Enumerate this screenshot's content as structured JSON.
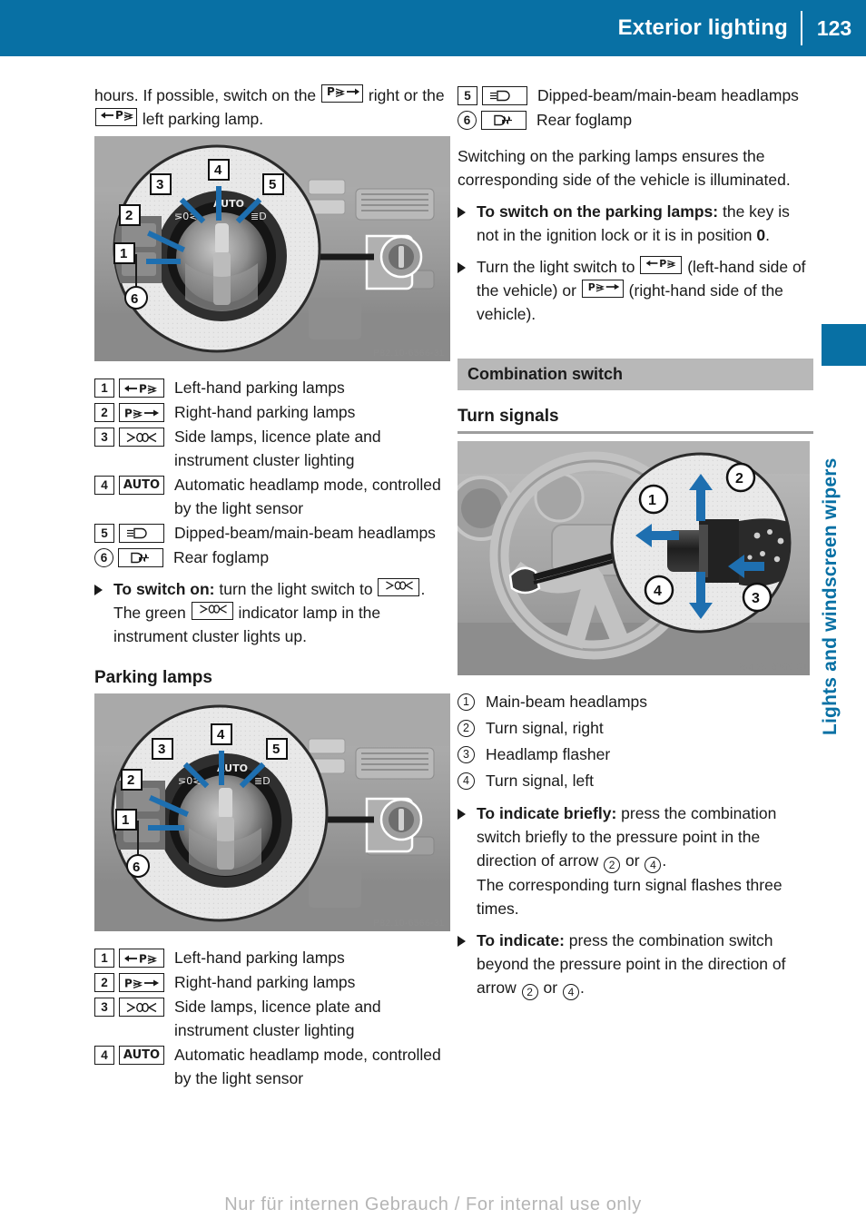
{
  "header": {
    "title": "Exterior lighting",
    "page_number": "123"
  },
  "side_tab": {
    "label": "Lights and windscreen wipers",
    "color": "#0870a4"
  },
  "footer": {
    "watermark": "Nur für internen Gebrauch / For internal use only"
  },
  "symbols": {
    "parking_left": "←P≤",
    "parking_right": "P≤→",
    "side_lamps": "⋝00⋜",
    "auto": "AUTO",
    "headlamps": "≣D",
    "rear_foglamp": "0⧧"
  },
  "left_column": {
    "intro_part1": "hours. If possible, switch on the",
    "intro_part2": "right or the",
    "intro_part3": "left parking lamp.",
    "figure_one": {
      "name": "light-switch-photo",
      "watermark_id": "P82.10-6566-31"
    },
    "legend_one": [
      {
        "num": "1",
        "shape": "square",
        "symbol": "←P≤",
        "symbol_kind": "parking-left",
        "text": "Left-hand parking lamps"
      },
      {
        "num": "2",
        "shape": "square",
        "symbol": "P≤→",
        "symbol_kind": "parking-right",
        "text": "Right-hand parking lamps"
      },
      {
        "num": "3",
        "shape": "square",
        "symbol": "⋝00⋜",
        "symbol_kind": "side-lamps",
        "text": "Side lamps, licence plate and instrument cluster lighting"
      },
      {
        "num": "4",
        "shape": "square",
        "symbol": "AUTO",
        "symbol_kind": "auto",
        "text": "Automatic headlamp mode, controlled by the light sensor"
      },
      {
        "num": "5",
        "shape": "square",
        "symbol": "≣D",
        "symbol_kind": "headlamp",
        "text": "Dipped-beam/main-beam headlamps"
      },
      {
        "num": "6",
        "shape": "circle",
        "symbol": "0⧧",
        "symbol_kind": "rear-foglamp",
        "text": "Rear foglamp"
      }
    ],
    "switch_on": {
      "lead": "To switch on:",
      "rest": "turn the light switch to",
      "after_symbol": ".",
      "follow_up_part1": "The green",
      "follow_up_part2": "indicator lamp in the instrument cluster lights up."
    },
    "parking_lamps_heading": "Parking lamps",
    "figure_two": {
      "name": "parking-lamps-switch-photo",
      "watermark_id": "P82.10-6566-31"
    },
    "legend_two": [
      {
        "num": "1",
        "shape": "square",
        "symbol": "←P≤",
        "symbol_kind": "parking-left",
        "text": "Left-hand parking lamps"
      },
      {
        "num": "2",
        "shape": "square",
        "symbol": "P≤→",
        "symbol_kind": "parking-right",
        "text": "Right-hand parking lamps"
      },
      {
        "num": "3",
        "shape": "square",
        "symbol": "⋝00⋜",
        "symbol_kind": "side-lamps",
        "text": "Side lamps, licence plate and instrument cluster lighting"
      },
      {
        "num": "4",
        "shape": "square",
        "symbol": "AUTO",
        "symbol_kind": "auto",
        "text": "Automatic headlamp mode, controlled by the light sensor"
      }
    ]
  },
  "right_column": {
    "legend_continued": [
      {
        "num": "5",
        "shape": "square",
        "symbol": "≣D",
        "symbol_kind": "headlamp",
        "text": "Dipped-beam/main-beam headlamps"
      },
      {
        "num": "6",
        "shape": "circle",
        "symbol": "0⧧",
        "symbol_kind": "rear-foglamp",
        "text": "Rear foglamp"
      }
    ],
    "paragraph": "Switching on the parking lamps ensures the corresponding side of the vehicle is illuminated.",
    "bullet_one": {
      "lead": "To switch on the parking lamps:",
      "rest": "the key is not in the ignition lock or it is in position",
      "bold_value": "0",
      "tail": "."
    },
    "bullet_two": {
      "part1": "Turn the light switch to",
      "part2": "(left-hand side of the vehicle) or",
      "part3": "(right-hand side of the vehicle)."
    },
    "section_heading": "Combination switch",
    "sub_heading": "Turn signals",
    "figure_three": {
      "name": "combination-switch-photo",
      "watermark_id": "P54.25-8766-31"
    },
    "turn_signal_legend": [
      {
        "num": "1",
        "text": "Main-beam headlamps"
      },
      {
        "num": "2",
        "text": "Turn signal, right"
      },
      {
        "num": "3",
        "text": "Headlamp flasher"
      },
      {
        "num": "4",
        "text": "Turn signal, left"
      }
    ],
    "bullet_three": {
      "lead": "To indicate briefly:",
      "rest": "press the combination switch briefly to the pressure point in the direction of arrow",
      "or": "or",
      "num_a": "2",
      "num_b": "4",
      "tail": ".",
      "follow_up": "The corresponding turn signal flashes three times."
    },
    "bullet_four": {
      "lead": "To indicate:",
      "rest": "press the combination switch beyond the pressure point in the direction of arrow",
      "or": "or",
      "num_a": "2",
      "num_b": "4",
      "tail": "."
    }
  }
}
